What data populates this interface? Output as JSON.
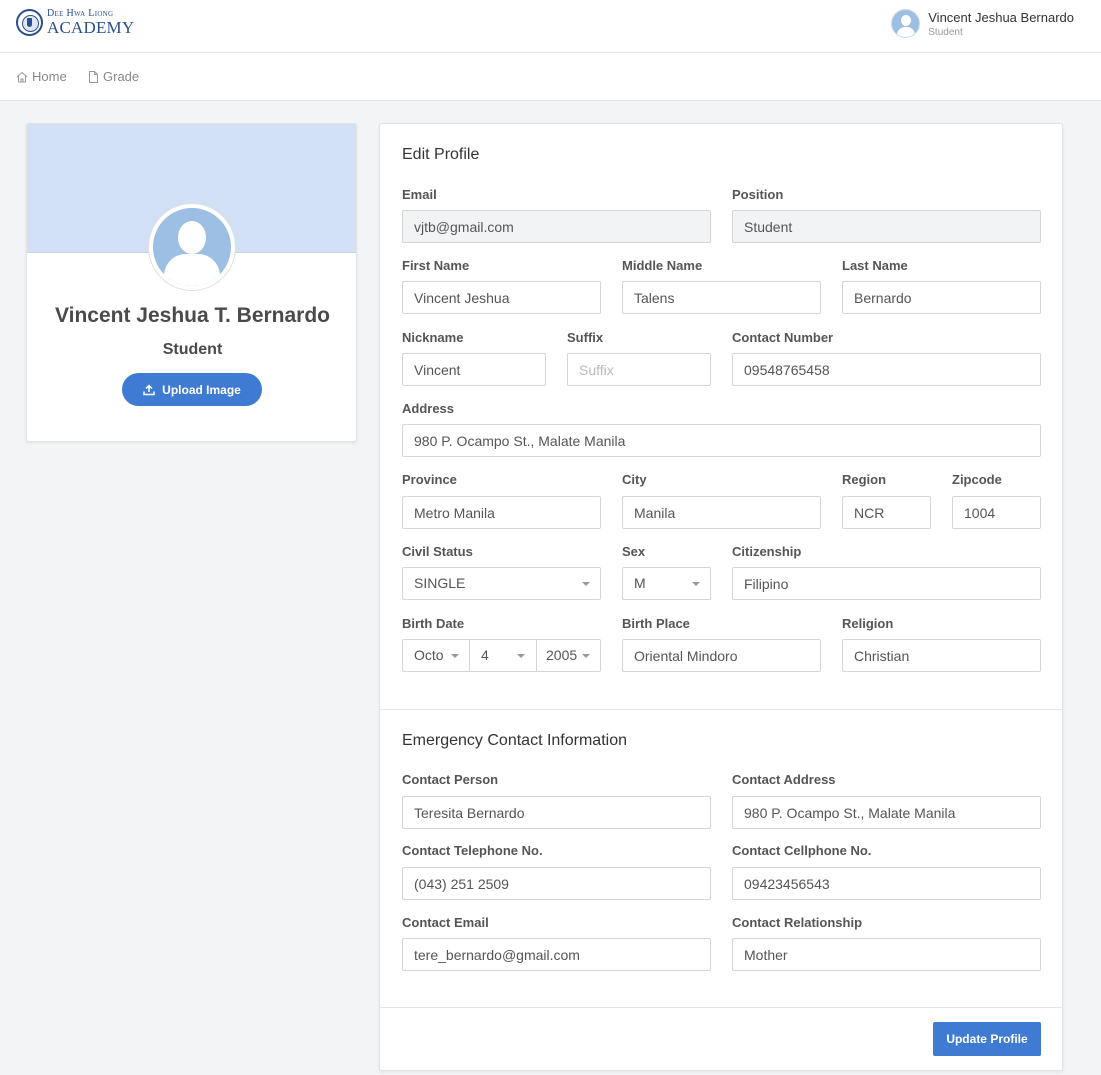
{
  "brand": {
    "line1": "Dee Hwa Liong",
    "line2": "ACADEMY"
  },
  "user": {
    "name": "Vincent Jeshua Bernardo",
    "role": "Student"
  },
  "nav": {
    "home": "Home",
    "grade": "Grade"
  },
  "profile": {
    "full_name": "Vincent Jeshua T. Bernardo",
    "role": "Student",
    "upload_label": "Upload Image"
  },
  "colors": {
    "accent": "#3f7ad3",
    "banner": "#d2e0f5",
    "avatar": "#9dbfe3"
  },
  "edit": {
    "title": "Edit Profile",
    "email": {
      "label": "Email",
      "value": "vjtb@gmail.com"
    },
    "position": {
      "label": "Position",
      "value": "Student"
    },
    "first_name": {
      "label": "First Name",
      "value": "Vincent Jeshua"
    },
    "middle_name": {
      "label": "Middle Name",
      "value": "Talens"
    },
    "last_name": {
      "label": "Last Name",
      "value": "Bernardo"
    },
    "nickname": {
      "label": "Nickname",
      "value": "Vincent"
    },
    "suffix": {
      "label": "Suffix",
      "placeholder": "Suffix"
    },
    "contact_number": {
      "label": "Contact Number",
      "value": "09548765458"
    },
    "address": {
      "label": "Address",
      "value": "980 P. Ocampo St., Malate Manila"
    },
    "province": {
      "label": "Province",
      "value": "Metro Manila"
    },
    "city": {
      "label": "City",
      "value": "Manila"
    },
    "region": {
      "label": "Region",
      "value": "NCR"
    },
    "zipcode": {
      "label": "Zipcode",
      "value": "1004"
    },
    "civil_status": {
      "label": "Civil Status",
      "value": "SINGLE"
    },
    "sex": {
      "label": "Sex",
      "value": "M"
    },
    "citizenship": {
      "label": "Citizenship",
      "value": "Filipino"
    },
    "birth_date": {
      "label": "Birth Date",
      "month": "Octo",
      "day": "4",
      "year": "2005"
    },
    "birth_place": {
      "label": "Birth Place",
      "value": "Oriental Mindoro"
    },
    "religion": {
      "label": "Religion",
      "value": "Christian"
    }
  },
  "emergency": {
    "title": "Emergency Contact Information",
    "contact_person": {
      "label": "Contact Person",
      "value": "Teresita Bernardo"
    },
    "contact_address": {
      "label": "Contact Address",
      "value": "980 P. Ocampo St., Malate Manila"
    },
    "contact_telephone": {
      "label": "Contact Telephone No.",
      "value": "(043) 251 2509"
    },
    "contact_cellphone": {
      "label": "Contact Cellphone No.",
      "value": "09423456543"
    },
    "contact_email": {
      "label": "Contact Email",
      "value": "tere_bernardo@gmail.com"
    },
    "contact_relationship": {
      "label": "Contact Relationship",
      "value": "Mother"
    }
  },
  "actions": {
    "update_label": "Update Profile"
  }
}
